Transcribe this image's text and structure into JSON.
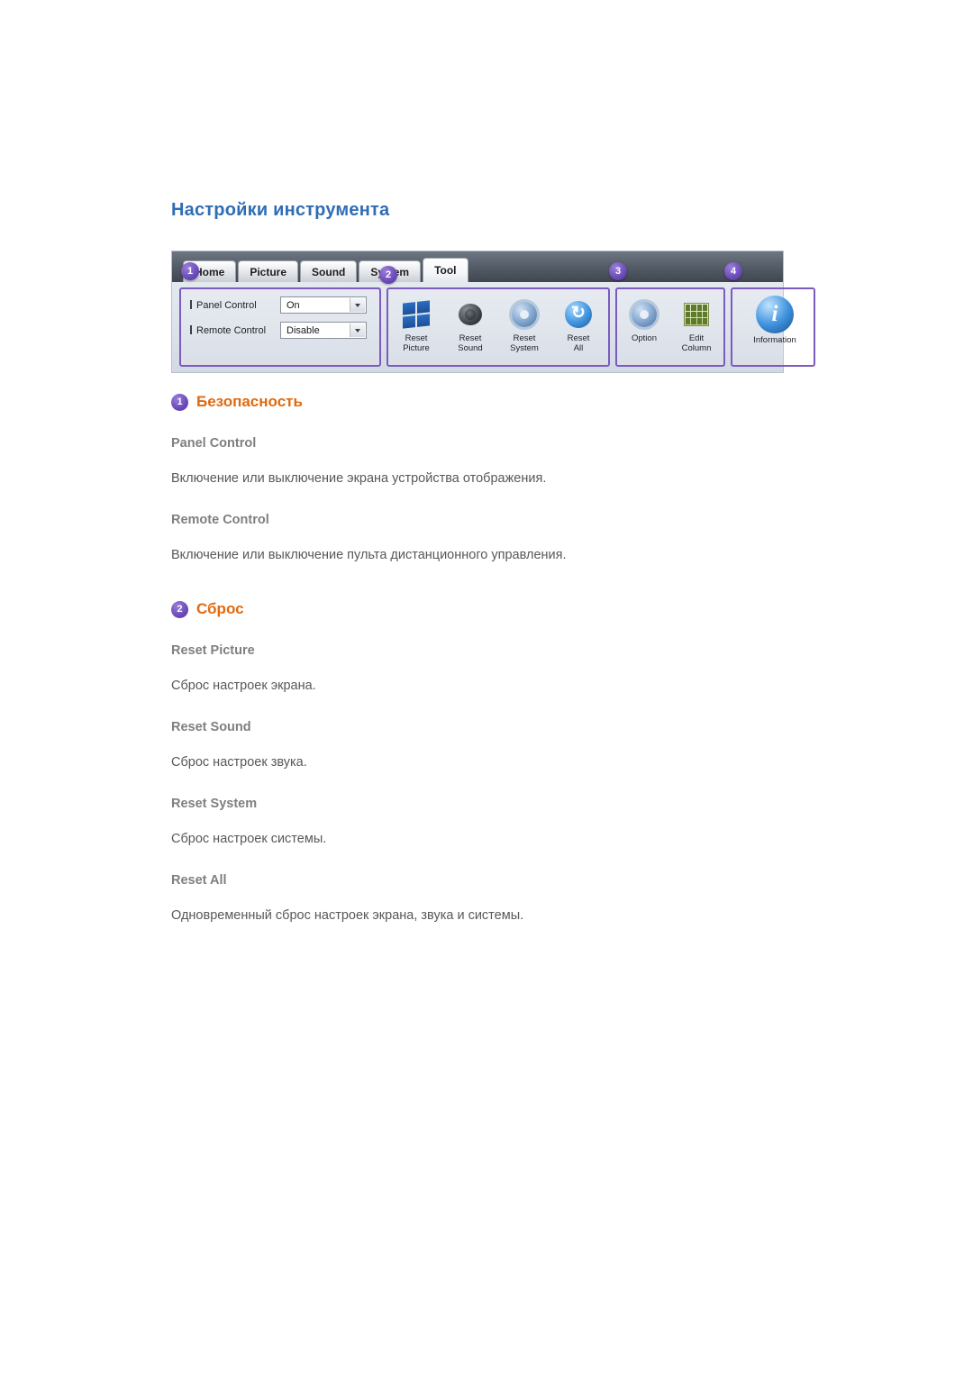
{
  "page": {
    "title": "Настройки инструмента"
  },
  "screenshot": {
    "tabs": [
      {
        "label": "Home",
        "active": false
      },
      {
        "label": "Picture",
        "active": false
      },
      {
        "label": "Sound",
        "active": false
      },
      {
        "label": "System",
        "active": false
      },
      {
        "label": "Tool",
        "active": true
      }
    ],
    "callouts": [
      "1",
      "2",
      "3",
      "4"
    ],
    "settings": [
      {
        "label": "Panel Control",
        "value": "On"
      },
      {
        "label": "Remote Control",
        "value": "Disable"
      }
    ],
    "reset_buttons": [
      {
        "line1": "Reset",
        "line2": "Picture",
        "icon": "windows-logo-icon",
        "badge": "↻"
      },
      {
        "line1": "Reset",
        "line2": "Sound",
        "icon": "speaker-icon",
        "badge": "↻"
      },
      {
        "line1": "Reset",
        "line2": "System",
        "icon": "gear-icon",
        "badge": "↻"
      },
      {
        "line1": "Reset",
        "line2": "All",
        "icon": "refresh-icon",
        "badge": ""
      }
    ],
    "option_buttons": [
      {
        "line1": "Option",
        "line2": "",
        "icon": "gear-icon"
      },
      {
        "line1": "Edit",
        "line2": "Column",
        "icon": "table-grid-icon"
      }
    ],
    "info_button": {
      "label": "Information",
      "icon": "info-icon"
    }
  },
  "sections": [
    {
      "num": "1",
      "title": "Безопасность",
      "items": [
        {
          "title": "Panel Control",
          "desc": "Включение или выключение экрана устройства отображения."
        },
        {
          "title": "Remote Control",
          "desc": "Включение или выключение пульта дистанционного управления."
        }
      ]
    },
    {
      "num": "2",
      "title": "Сброс",
      "items": [
        {
          "title": "Reset Picture",
          "desc": "Сброс настроек экрана."
        },
        {
          "title": "Reset Sound",
          "desc": "Сброс настроек звука."
        },
        {
          "title": "Reset System",
          "desc": "Сброс настроек системы."
        },
        {
          "title": "Reset All",
          "desc": "Одновременный сброс настроек экрана, звука и системы."
        }
      ]
    }
  ],
  "colors": {
    "heading": "#2f6db5",
    "section_heading": "#e06a10",
    "item_title": "#7f7f7f",
    "body_text": "#58585a",
    "callout": "#6f4fbd"
  }
}
